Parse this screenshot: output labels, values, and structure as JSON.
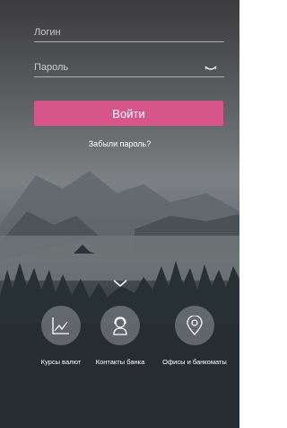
{
  "login": {
    "login_placeholder": "Логин",
    "password_placeholder": "Пароль",
    "submit_label": "Войти",
    "forgot_link": "Забыли пароль?"
  },
  "actions": [
    {
      "label": "Курсы валют",
      "icon": "chart-icon"
    },
    {
      "label": "Контакты банка",
      "icon": "support-agent-icon"
    },
    {
      "label": "Офисы и банкоматы",
      "icon": "map-pin-icon"
    }
  ],
  "colors": {
    "accent": "#d6568a"
  }
}
